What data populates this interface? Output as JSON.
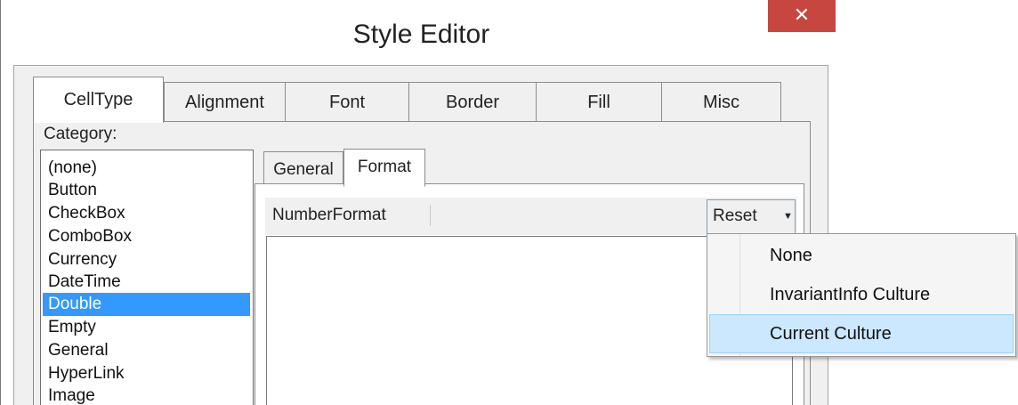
{
  "window": {
    "title": "Style Editor",
    "close_glyph": "✕"
  },
  "tabs": [
    {
      "label": "CellType",
      "active": true
    },
    {
      "label": "Alignment"
    },
    {
      "label": "Font"
    },
    {
      "label": "Border"
    },
    {
      "label": "Fill"
    },
    {
      "label": "Misc"
    }
  ],
  "category": {
    "label": "Category:",
    "items": [
      "(none)",
      "Button",
      "CheckBox",
      "ComboBox",
      "Currency",
      "DateTime",
      "Double",
      "Empty",
      "General",
      "HyperLink",
      "Image"
    ],
    "selected": "Double"
  },
  "subtabs": [
    {
      "label": "General"
    },
    {
      "label": "Format",
      "active": true
    }
  ],
  "property_grid": {
    "label": "NumberFormat"
  },
  "reset": {
    "label": "Reset",
    "caret": "▼"
  },
  "dropdown_menu": {
    "items": [
      "None",
      "InvariantInfo Culture",
      "Current Culture"
    ],
    "highlighted": "Current Culture"
  },
  "colors": {
    "close": "#c7463f",
    "selection": "#3399ff",
    "menu_highlight": "#cce8ff"
  }
}
